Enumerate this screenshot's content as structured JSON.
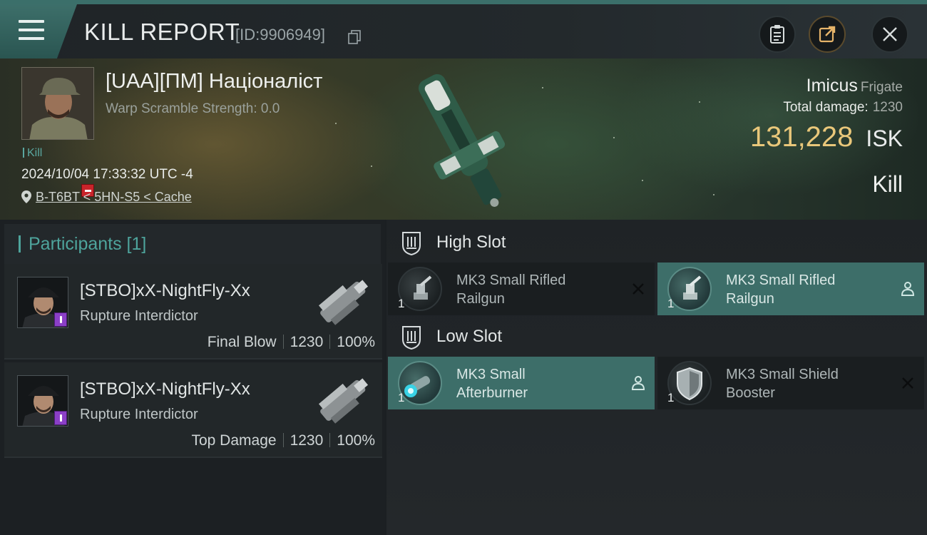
{
  "header": {
    "title": "KILL REPORT",
    "report_id": "[ID:9906949]",
    "menu_icon": "hamburger-icon",
    "buttons": [
      {
        "icon": "clipboard-icon"
      },
      {
        "icon": "share-icon"
      },
      {
        "icon": "close-icon"
      }
    ]
  },
  "victim": {
    "name": "[UAA][ПМ] Націоналіст",
    "warp_scramble": "Warp Scramble Strength: 0.0",
    "tag": "Kill",
    "datetime": "2024/10/04 17:33:32 UTC -4",
    "location": "B-T6BT < 5HN-S5 < Cache",
    "ship_name": "Imicus",
    "ship_class": "Frigate",
    "total_damage_label": "Total damage:",
    "total_damage": "1230",
    "isk_value": "131,228",
    "isk_unit": "ISK",
    "result": "Kill"
  },
  "participants": {
    "label": "Participants [1]",
    "items": [
      {
        "name": "[STBO]xX-NightFly-Xx",
        "ship": "Rupture Interdictor",
        "role": "Final Blow",
        "damage": "1230",
        "percent": "100%"
      },
      {
        "name": "[STBO]xX-NightFly-Xx",
        "ship": "Rupture Interdictor",
        "role": "Top Damage",
        "damage": "1230",
        "percent": "100%"
      }
    ]
  },
  "slots": {
    "high": {
      "label": "High Slot",
      "modules": [
        {
          "name": "MK3 Small Rifled Railgun",
          "line1": "MK3 Small Rifled",
          "line2": "Railgun",
          "qty": "1",
          "state": "destroyed",
          "action_icon": "close-icon"
        },
        {
          "name": "MK3 Small Rifled Railgun",
          "line1": "MK3 Small Rifled",
          "line2": "Railgun",
          "qty": "1",
          "state": "dropped",
          "action_icon": "person-icon"
        }
      ]
    },
    "low": {
      "label": "Low Slot",
      "modules": [
        {
          "name": "MK3 Small Afterburner",
          "line1": "MK3 Small",
          "line2": "Afterburner",
          "qty": "1",
          "state": "dropped",
          "action_icon": "person-icon"
        },
        {
          "name": "MK3 Small Shield Booster",
          "line1": "MK3 Small Shield",
          "line2": "Booster",
          "qty": "1",
          "state": "destroyed",
          "action_icon": "close-icon"
        }
      ]
    }
  },
  "colors": {
    "accent_teal": "#4ea49c",
    "isk_gold": "#e9c77a",
    "active_module_bg": "#3d6e69",
    "victim_badge_red": "#c8242a",
    "participant_badge_purple": "#8b3fc7"
  }
}
